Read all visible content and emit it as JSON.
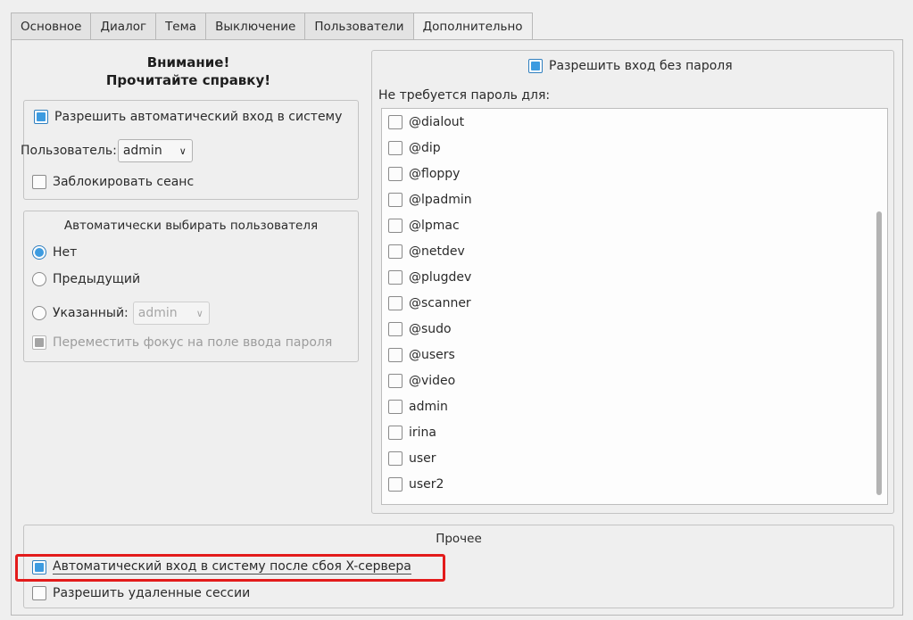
{
  "tabs": [
    "Основное",
    "Диалог",
    "Тема",
    "Выключение",
    "Пользователи",
    "Дополнительно"
  ],
  "warning": {
    "line1": "Внимание!",
    "line2": "Прочитайте справку!"
  },
  "autologin": {
    "enable_label": "Разрешить автоматический вход в систему",
    "user_label": "Пользователь:",
    "user_value": "admin",
    "lock_label": "Заблокировать сеанс"
  },
  "preselect": {
    "title": "Автоматически выбирать пользователя",
    "none_label": "Нет",
    "previous_label": "Предыдущий",
    "specified_label": "Указанный:",
    "specified_value": "admin",
    "focus_label": "Переместить фокус на поле ввода пароля"
  },
  "nopassword": {
    "enable_label": "Разрешить вход без пароля",
    "list_caption": "Не требуется пароль для:",
    "items": [
      "@dialout",
      "@dip",
      "@floppy",
      "@lpadmin",
      "@lpmac",
      "@netdev",
      "@plugdev",
      "@scanner",
      "@sudo",
      "@users",
      "@video",
      "admin",
      "irina",
      "user",
      "user2"
    ]
  },
  "misc": {
    "title": "Прочее",
    "xcrash_label": "Автоматический вход в систему после сбоя X-сервера",
    "remote_label": "Разрешить удаленные сессии"
  },
  "colors": {
    "accent": "#3d9be0",
    "highlight_frame": "#e31b1b"
  }
}
